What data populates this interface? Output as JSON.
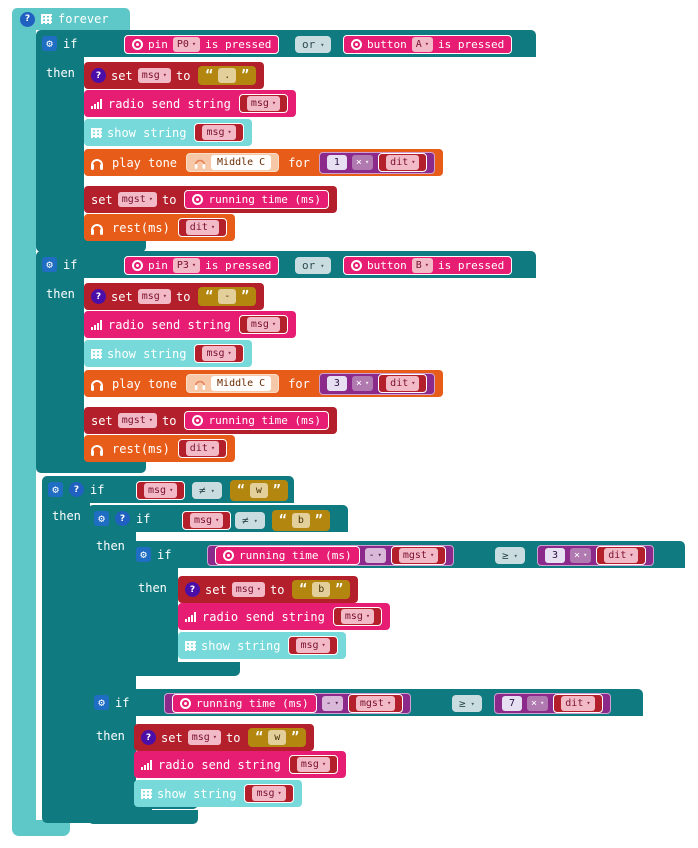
{
  "app": {
    "title": "forever",
    "canvas_bg": "#ffffff"
  },
  "colors": {
    "loop": "#5ec8c8",
    "logic": "#0f7a80",
    "variables": "#b3202b",
    "radio": "#e61d72",
    "basic": "#77d9d9",
    "music": "#e85c19",
    "math": "#8c2a8c",
    "text": "#b3860f",
    "input": "#e61d72"
  },
  "labels": {
    "if": "if",
    "then": "then",
    "or": "or",
    "neq": "≠",
    "gte": "≥",
    "minus": "-",
    "times": "×",
    "pin": "pin",
    "is_pressed": "is pressed",
    "button": "button",
    "set": "set",
    "to": "to",
    "radio_send_string": "radio send string",
    "show_string": "show string",
    "play_tone": "play tone",
    "for": "for",
    "rest_ms": "rest(ms)",
    "running_time": "running time (ms)",
    "gear_icon": "⚙",
    "question_icon": "?",
    "caret": "▾"
  },
  "vars": {
    "msg": "msg",
    "mgst": "mgst",
    "dit": "dit"
  },
  "blocks": {
    "branch1": {
      "cond": {
        "left": {
          "kind": "pin-pressed",
          "pin": "P0"
        },
        "op": "or",
        "right": {
          "kind": "button-pressed",
          "button": "A"
        }
      },
      "body": {
        "set_msg_value": ".",
        "tone_note": "Middle C",
        "tone_multiplier": "1",
        "tone_unit": "dit",
        "set_mgst_source": "running time (ms)",
        "rest_value": "dit"
      }
    },
    "branch2": {
      "cond": {
        "left": {
          "kind": "pin-pressed",
          "pin": "P3"
        },
        "op": "or",
        "right": {
          "kind": "button-pressed",
          "button": "B"
        }
      },
      "body": {
        "set_msg_value": "-",
        "tone_note": "Middle C",
        "tone_multiplier": "3",
        "tone_unit": "dit",
        "set_mgst_source": "running time (ms)",
        "rest_value": "dit"
      }
    },
    "branch3": {
      "cond": {
        "left": "msg",
        "op": "≠",
        "right": "w"
      },
      "inner": {
        "cond": {
          "left": "msg",
          "op": "≠",
          "right": "b"
        },
        "if_a": {
          "cond": {
            "left": "running time (ms)",
            "minus": "-",
            "var": "mgst",
            "cmp": "≥",
            "factor": "3",
            "times": "×",
            "unit": "dit"
          },
          "body": {
            "set_msg_value": "b"
          }
        },
        "if_b": {
          "cond": {
            "left": "running time (ms)",
            "minus": "-",
            "var": "mgst",
            "cmp": "≥",
            "factor": "7",
            "times": "×",
            "unit": "dit"
          },
          "body": {
            "set_msg_value": "w"
          }
        }
      }
    }
  }
}
